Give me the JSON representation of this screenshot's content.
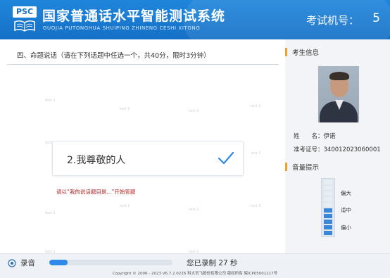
{
  "header": {
    "logo_text": "PSC",
    "system_title": "国家普通话水平智能测试系统",
    "system_pinyin": "GUOJIA PUTONGHUA SHUIPING ZHINENG CESHI XITONG",
    "machine_label": "考试机号：",
    "machine_number": "5"
  },
  "exam": {
    "question": "四、命题说话（请在下列话题中任选一个，共40分，限时3分钟）",
    "selected_topic": "2.我尊敬的人",
    "hint": "请以“我的说话题目是...”开始答题",
    "watermark": "test-1"
  },
  "sidebar": {
    "candidate_heading": "考生信息",
    "name_label": "姓　　名：",
    "name_value": "伊诺",
    "ticket_label": "准考证号：",
    "ticket_value": "340012023060001",
    "volume_heading": "音量提示",
    "volume_labels": [
      "偏大",
      "适中",
      "偏小"
    ],
    "volume_level": 0.5
  },
  "footer": {
    "record_label": "录音",
    "record_progress": 0.15,
    "record_status": "您已录制 27 秒",
    "copyright": "Copyright © 2006 - 2023 V6.7.2.0226 科大讯飞股份有限公司 版权所有 皖ICP05001217号"
  },
  "colors": {
    "header": "#1570c6",
    "accent": "#f0a030",
    "hint": "#b02020",
    "progress": "#2e8ae6"
  }
}
